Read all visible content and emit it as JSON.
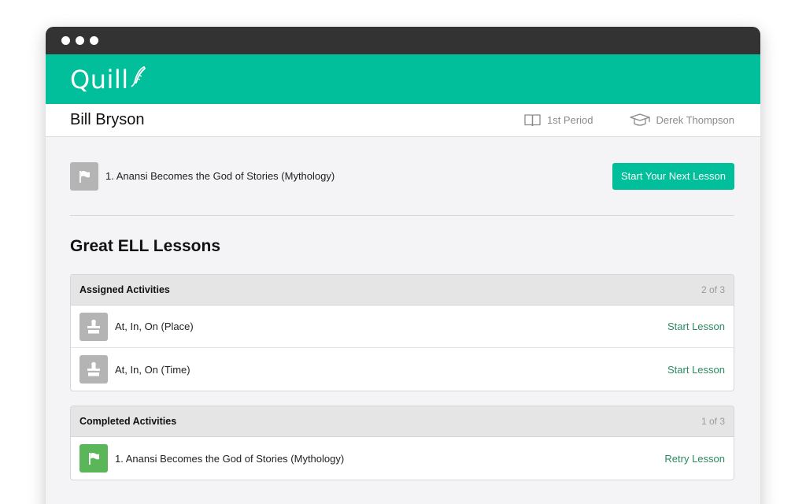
{
  "app": {
    "name": "Quill"
  },
  "student": {
    "name": "Bill Bryson",
    "period": "1st Period",
    "teacher": "Derek Thompson"
  },
  "next_lesson": {
    "title": "1. Anansi Becomes the God of Stories (Mythology)",
    "button": "Start Your Next Lesson"
  },
  "unit": {
    "title": "Great ELL Lessons"
  },
  "assigned": {
    "title": "Assigned Activities",
    "count": "2 of 3",
    "items": [
      {
        "name": "At, In, On (Place)",
        "action": "Start Lesson"
      },
      {
        "name": "At, In, On (Time)",
        "action": "Start Lesson"
      }
    ]
  },
  "completed": {
    "title": "Completed Activities",
    "count": "1 of 3",
    "items": [
      {
        "name": "1. Anansi Becomes the God of Stories (Mythology)",
        "action": "Retry Lesson"
      }
    ]
  },
  "colors": {
    "brand": "#00bf9a",
    "titlebar": "#333333",
    "completed_icon": "#5bb65a",
    "action_link": "#2a8a5f"
  },
  "icons": {
    "period": "book-icon",
    "teacher": "graduation-cap-icon",
    "lesson": "flag-icon",
    "activity": "puzzle-icon"
  }
}
